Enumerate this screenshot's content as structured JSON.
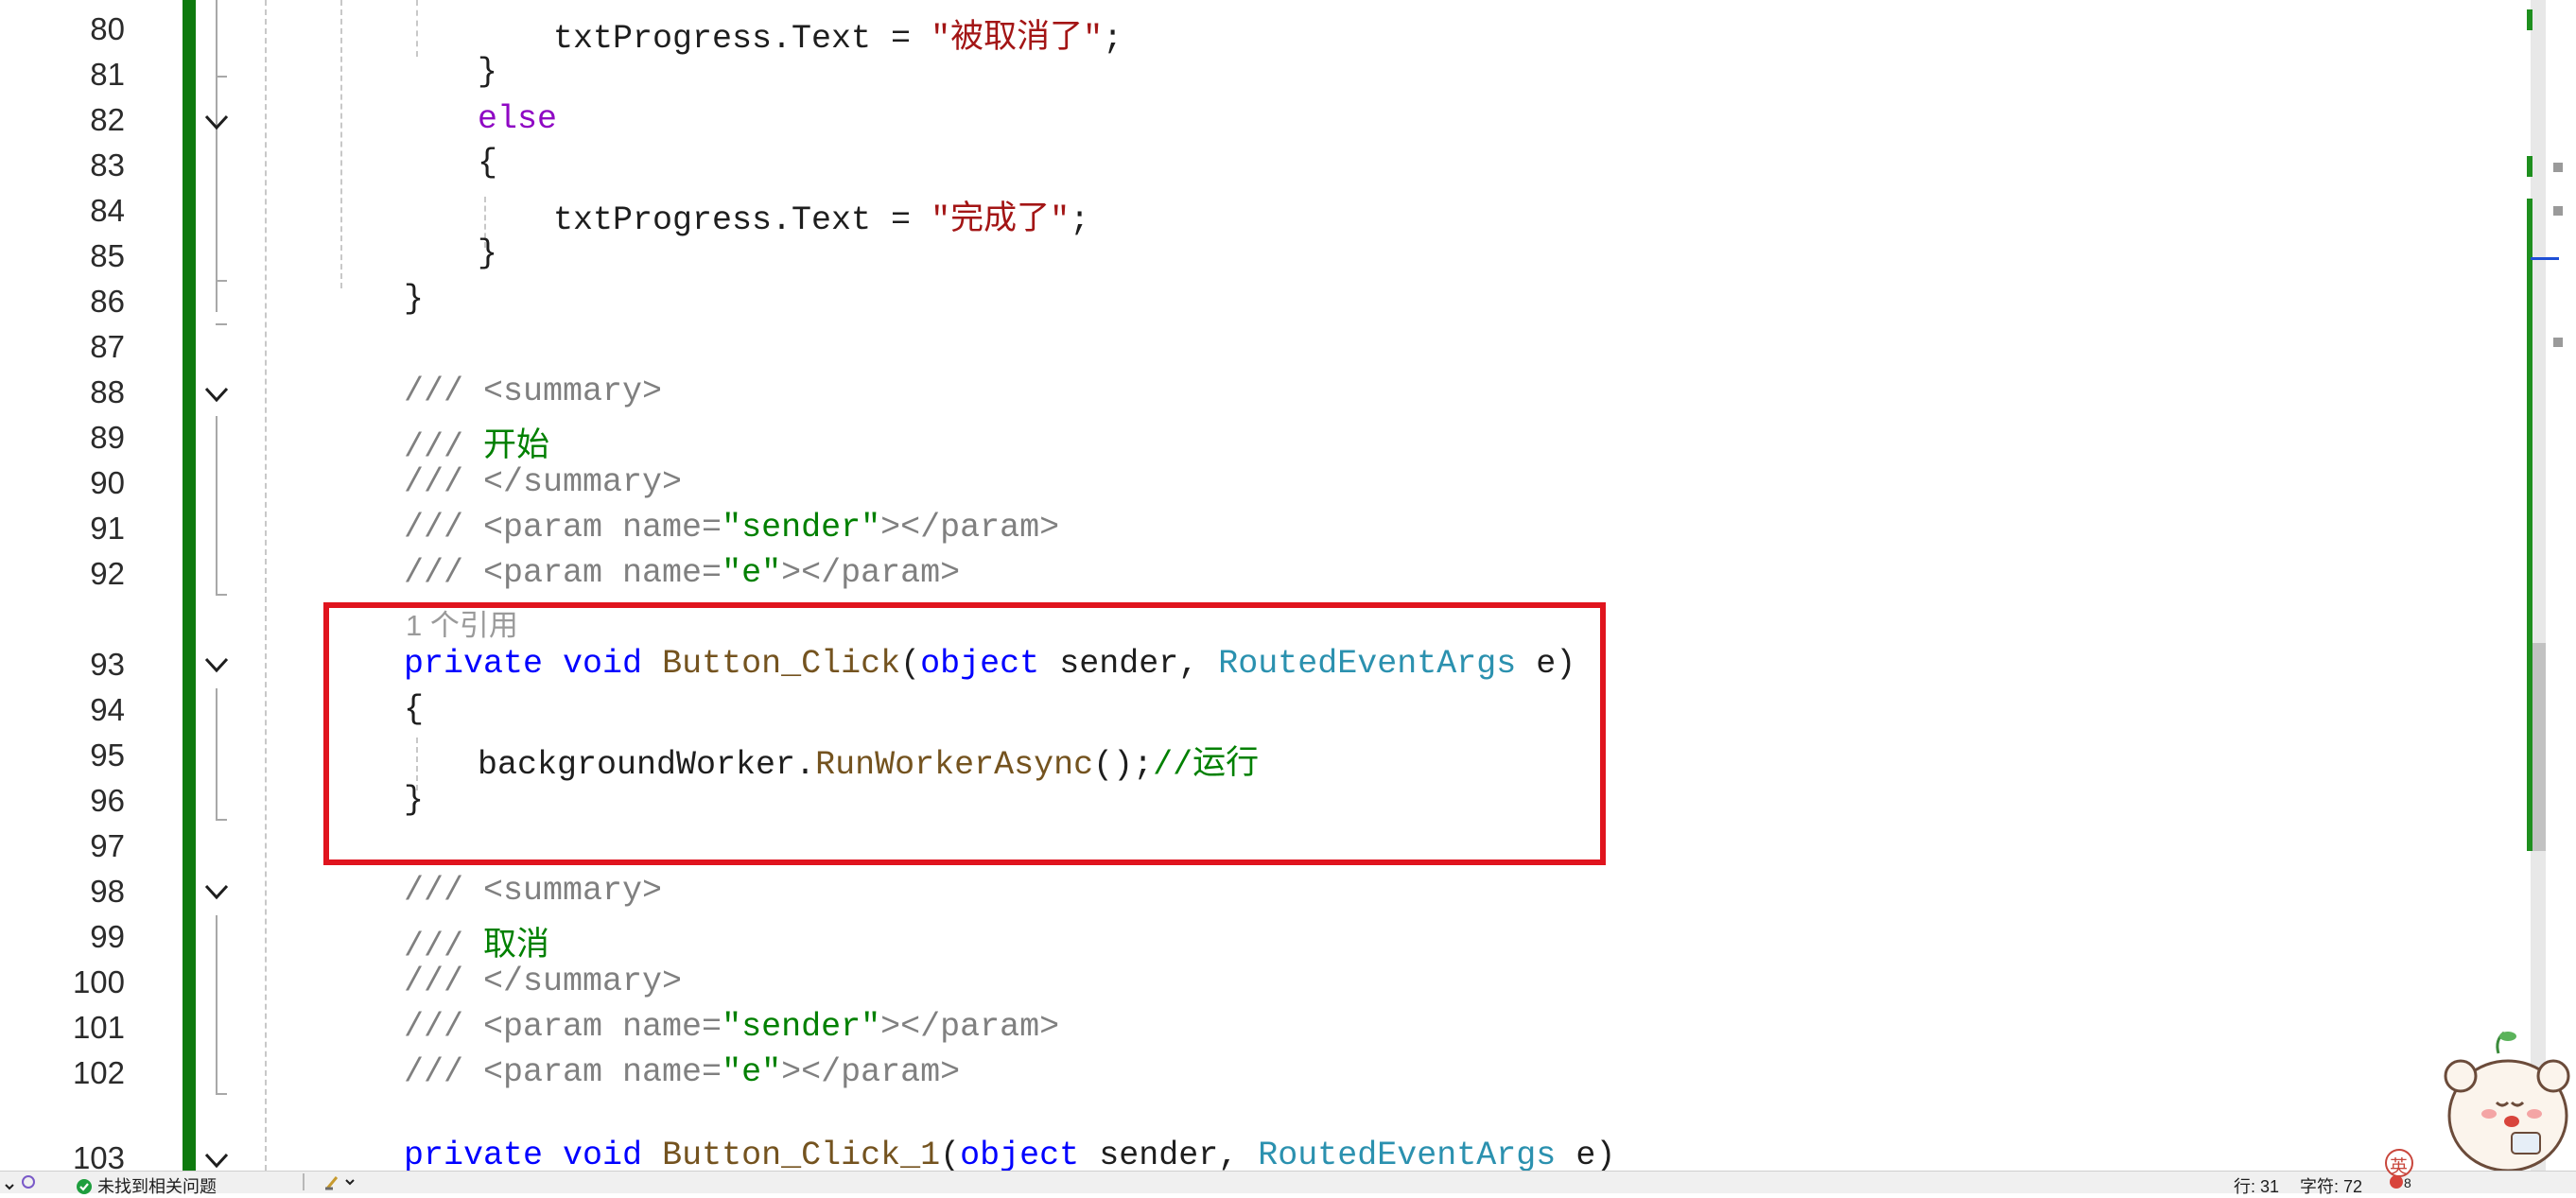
{
  "editor": {
    "lines": [
      {
        "num": "80"
      },
      {
        "num": "81"
      },
      {
        "num": "82"
      },
      {
        "num": "83"
      },
      {
        "num": "84"
      },
      {
        "num": "85"
      },
      {
        "num": "86"
      },
      {
        "num": "87"
      },
      {
        "num": "88"
      },
      {
        "num": "89"
      },
      {
        "num": "90"
      },
      {
        "num": "91"
      },
      {
        "num": "92"
      },
      {
        "num": "93"
      },
      {
        "num": "94"
      },
      {
        "num": "95"
      },
      {
        "num": "96"
      },
      {
        "num": "97"
      },
      {
        "num": "98"
      },
      {
        "num": "99"
      },
      {
        "num": "100"
      },
      {
        "num": "101"
      },
      {
        "num": "102"
      },
      {
        "num": "103"
      }
    ],
    "code": {
      "l80": {
        "obj": "txtProgress.Text = ",
        "str": "\"被取消了\"",
        "end": ";"
      },
      "l81": "}",
      "l82": "else",
      "l83": "{",
      "l84": {
        "obj": "txtProgress.Text = ",
        "str": "\"完成了\"",
        "end": ";"
      },
      "l85": "}",
      "l86": "}",
      "l88": {
        "slashes": "/// ",
        "tag": "<summary>"
      },
      "l89": {
        "slashes": "/// ",
        "text": "开始"
      },
      "l90": {
        "slashes": "/// ",
        "tag": "</summary>"
      },
      "l91": {
        "slashes": "/// ",
        "open": "<param name=",
        "val": "\"sender\"",
        "close": "></param>"
      },
      "l92": {
        "slashes": "/// ",
        "open": "<param name=",
        "val": "\"e\"",
        "close": "></param>"
      },
      "ref93": "1 个引用",
      "l93": {
        "kw1": "private",
        "kw2": "void",
        "method": "Button_Click",
        "p1type": "object",
        "p1": "sender, ",
        "p2type": "RoutedEventArgs",
        "p2": "e)"
      },
      "l94": "{",
      "l95": {
        "obj": "backgroundWorker.",
        "method": "RunWorkerAsync",
        "punct": "();",
        "comment": "//运行"
      },
      "l96": "}",
      "l98": {
        "slashes": "/// ",
        "tag": "<summary>"
      },
      "l99": {
        "slashes": "/// ",
        "text": "取消"
      },
      "l100": {
        "slashes": "/// ",
        "tag": "</summary>"
      },
      "l101": {
        "slashes": "/// ",
        "open": "<param name=",
        "val": "\"sender\"",
        "close": "></param>"
      },
      "l102": {
        "slashes": "/// ",
        "open": "<param name=",
        "val": "\"e\"",
        "close": "></param>"
      },
      "l103": {
        "kw1": "private",
        "kw2": "void",
        "method": "Button_Click_1",
        "p1type": "object",
        "p1": "sender, ",
        "p2type": "RoutedEventArgs",
        "p2": "e)"
      }
    }
  },
  "status_bar": {
    "issues": "未找到相关问题",
    "line": "行: 31",
    "char": "字符: 72",
    "ime": "英"
  },
  "colors": {
    "highlight_box": "#e0141e",
    "change_bar": "#0e7a0e"
  }
}
